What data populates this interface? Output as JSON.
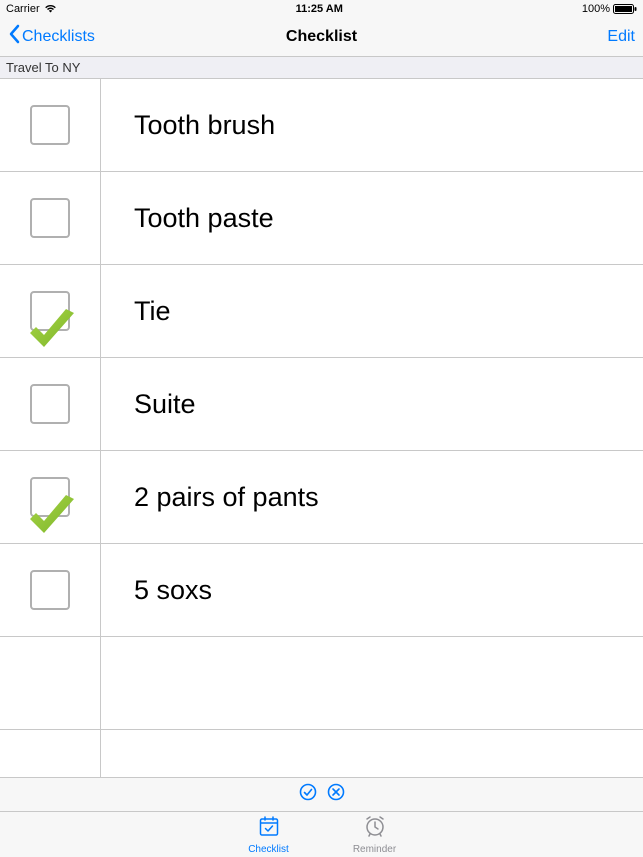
{
  "status": {
    "carrier": "Carrier",
    "time": "11:25 AM",
    "battery_pct": "100%"
  },
  "nav": {
    "back_label": "Checklists",
    "title": "Checklist",
    "edit_label": "Edit"
  },
  "section": {
    "title": "Travel To NY"
  },
  "items": [
    {
      "label": "Tooth brush",
      "checked": false
    },
    {
      "label": "Tooth paste",
      "checked": false
    },
    {
      "label": "Tie",
      "checked": true
    },
    {
      "label": "Suite",
      "checked": false
    },
    {
      "label": "2 pairs of pants",
      "checked": true
    },
    {
      "label": "5 soxs",
      "checked": false
    }
  ],
  "tabs": {
    "checklist": "Checklist",
    "reminder": "Reminder"
  }
}
